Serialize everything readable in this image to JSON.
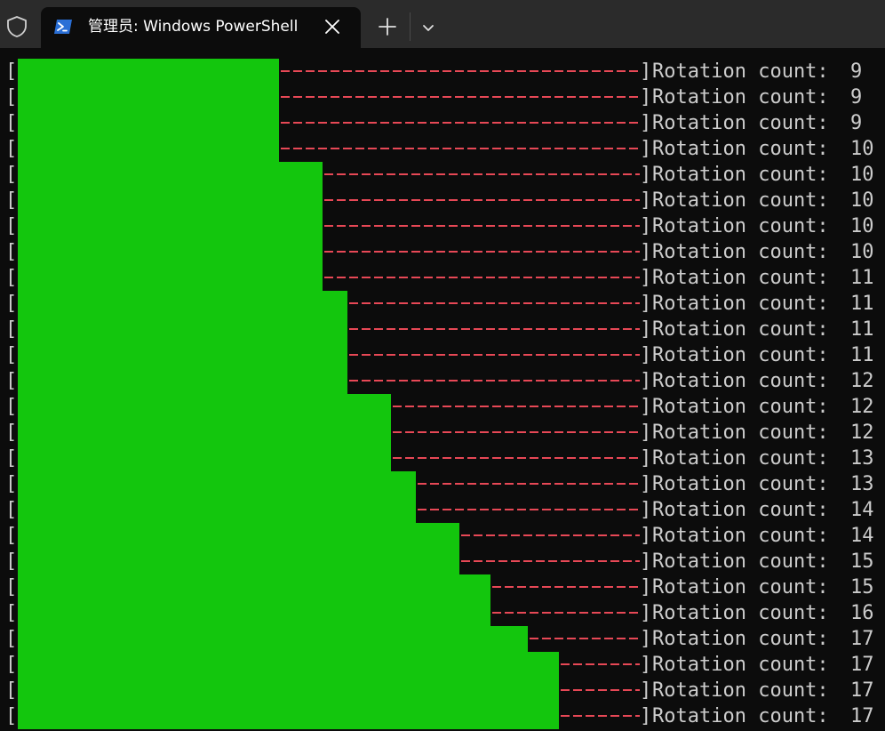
{
  "titlebar": {
    "shield_icon": "shield-icon",
    "tab": {
      "icon": "powershell-icon",
      "title": "管理员: Windows PowerShell",
      "close_icon": "close-icon"
    },
    "new_tab_icon": "plus-icon",
    "dropdown_icon": "chevron-down-icon"
  },
  "colors": {
    "background": "#0c0c0c",
    "titlebar": "#2b2b2b",
    "progress_fill": "#13c60d",
    "progress_remaining": "#e74856",
    "text": "#cccccc"
  },
  "terminal": {
    "open_bracket": "[",
    "close_bracket": "]",
    "label": "Rotation count:",
    "rows": [
      {
        "progress": 0.42,
        "count": "9"
      },
      {
        "progress": 0.42,
        "count": "9"
      },
      {
        "progress": 0.42,
        "count": "9"
      },
      {
        "progress": 0.42,
        "count": "10"
      },
      {
        "progress": 0.49,
        "count": "10"
      },
      {
        "progress": 0.49,
        "count": "10"
      },
      {
        "progress": 0.49,
        "count": "10"
      },
      {
        "progress": 0.49,
        "count": "10"
      },
      {
        "progress": 0.49,
        "count": "11"
      },
      {
        "progress": 0.53,
        "count": "11"
      },
      {
        "progress": 0.53,
        "count": "11"
      },
      {
        "progress": 0.53,
        "count": "11"
      },
      {
        "progress": 0.53,
        "count": "12"
      },
      {
        "progress": 0.6,
        "count": "12"
      },
      {
        "progress": 0.6,
        "count": "12"
      },
      {
        "progress": 0.6,
        "count": "13"
      },
      {
        "progress": 0.64,
        "count": "13"
      },
      {
        "progress": 0.64,
        "count": "14"
      },
      {
        "progress": 0.71,
        "count": "14"
      },
      {
        "progress": 0.71,
        "count": "15"
      },
      {
        "progress": 0.76,
        "count": "15"
      },
      {
        "progress": 0.76,
        "count": "16"
      },
      {
        "progress": 0.82,
        "count": "17"
      },
      {
        "progress": 0.87,
        "count": "17"
      },
      {
        "progress": 0.87,
        "count": "17"
      },
      {
        "progress": 0.87,
        "count": "17"
      }
    ]
  }
}
